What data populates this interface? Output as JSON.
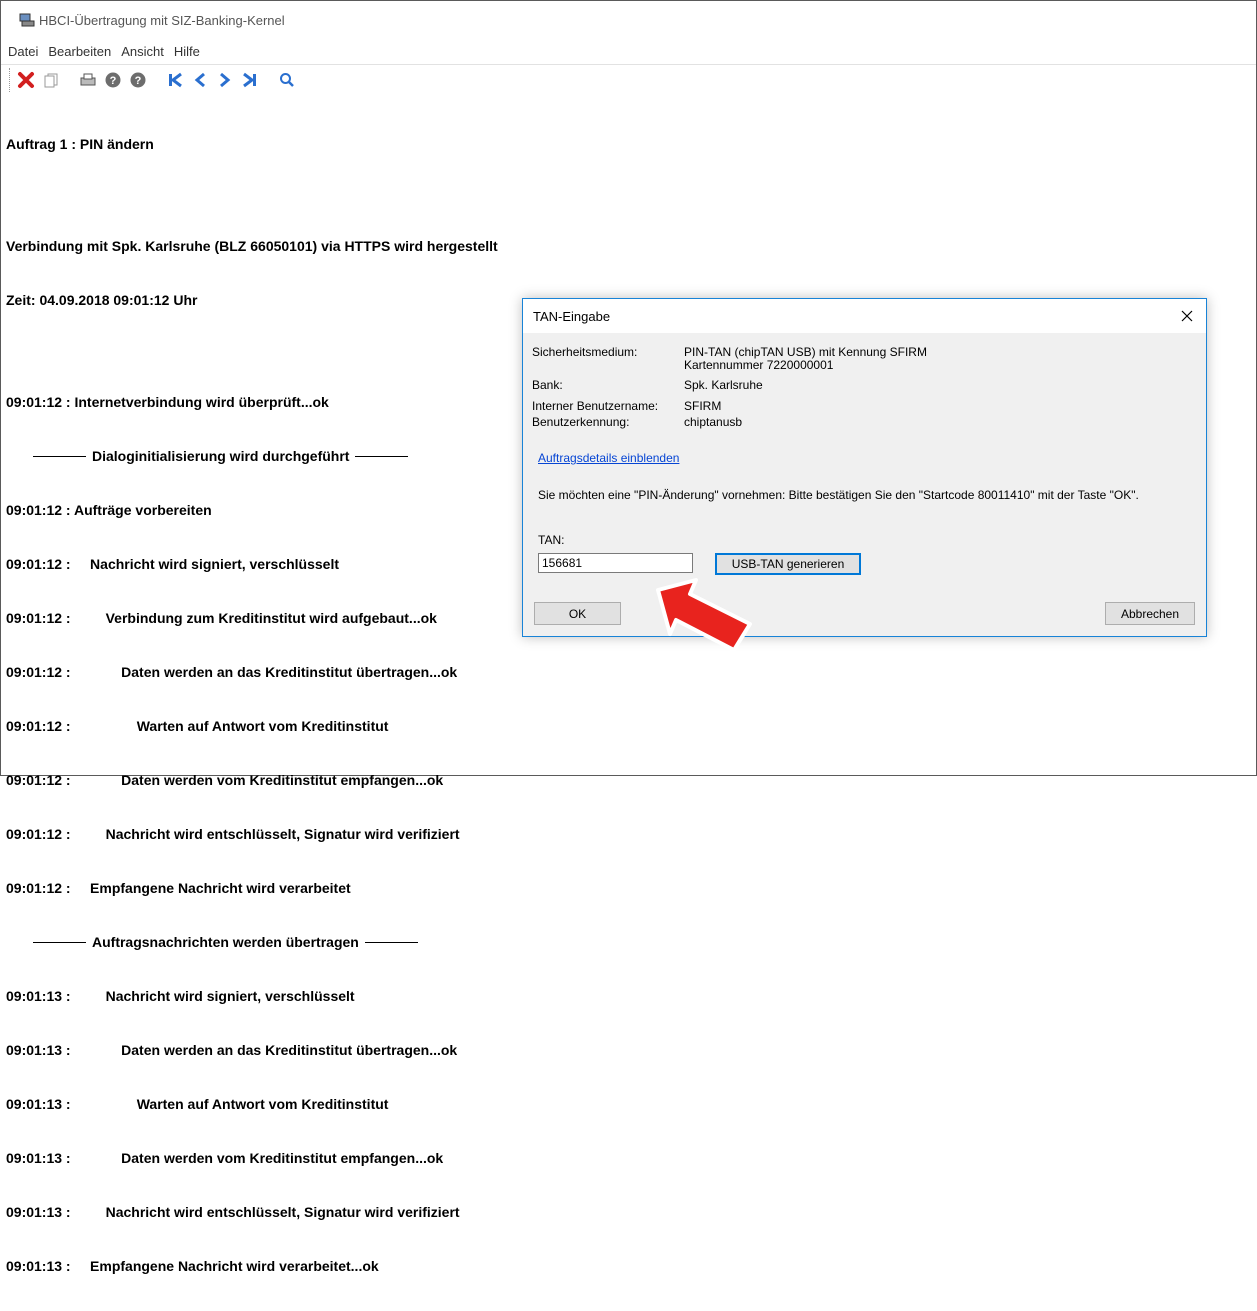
{
  "window": {
    "title": "HBCI-Übertragung mit SIZ-Banking-Kernel"
  },
  "menu": [
    "Datei",
    "Bearbeiten",
    "Ansicht",
    "Hilfe"
  ],
  "toolbar": {
    "icons": [
      "cancel-icon",
      "copy-icon",
      "print-icon",
      "help-icon",
      "info-icon",
      "first-icon",
      "prev-icon",
      "next-icon",
      "last-icon",
      "search-icon"
    ]
  },
  "log": {
    "lines": [
      "Auftrag 1 : PIN ändern",
      "",
      "Verbindung mit Spk. Karlsruhe (BLZ 66050101) via HTTPS wird hergestellt",
      "Zeit: 04.09.2018 09:01:12 Uhr",
      "",
      "09:01:12 : Internetverbindung wird überprüft...ok",
      "Dialoginitialisierung wird durchgeführt",
      "09:01:12 : Aufträge vorbereiten",
      "09:01:12 :     Nachricht wird signiert, verschlüsselt",
      "09:01:12 :         Verbindung zum Kreditinstitut wird aufgebaut...ok",
      "09:01:12 :             Daten werden an das Kreditinstitut übertragen...ok",
      "09:01:12 :                 Warten auf Antwort vom Kreditinstitut",
      "09:01:12 :             Daten werden vom Kreditinstitut empfangen...ok",
      "09:01:12 :         Nachricht wird entschlüsselt, Signatur wird verifiziert",
      "09:01:12 :     Empfangene Nachricht wird verarbeitet",
      "Auftragsnachrichten werden übertragen",
      "09:01:13 :         Nachricht wird signiert, verschlüsselt",
      "09:01:13 :             Daten werden an das Kreditinstitut übertragen...ok",
      "09:01:13 :                 Warten auf Antwort vom Kreditinstitut",
      "09:01:13 :             Daten werden vom Kreditinstitut empfangen...ok",
      "09:01:13 :         Nachricht wird entschlüsselt, Signatur wird verifiziert",
      "09:01:13 :     Empfangene Nachricht wird verarbeitet...ok"
    ]
  },
  "dialog": {
    "title": "TAN-Eingabe",
    "fields": [
      {
        "label": "Sicherheitsmedium:",
        "value": "PIN-TAN (chipTAN USB) mit Kennung SFIRM",
        "value2": "Kartennummer 7220000001"
      },
      {
        "label": "Bank:",
        "value": "Spk. Karlsruhe"
      },
      {
        "label": "Interner Benutzername:",
        "value": "SFIRM"
      },
      {
        "label": "Benutzerkennung:",
        "value": "chiptanusb"
      }
    ],
    "details_link": "Auftragsdetails einblenden",
    "message": "Sie möchten eine \"PIN-Änderung\" vornehmen: Bitte bestätigen Sie den \"Startcode 80011410\" mit der Taste \"OK\".",
    "tan_label": "TAN:",
    "tan_value": "156681",
    "generate_button": "USB-TAN generieren",
    "ok_button": "OK",
    "cancel_button": "Abbrechen"
  },
  "colors": {
    "arrow": "#e8231e",
    "link": "#0645d4",
    "dialog_border": "#1883d7",
    "toolbar_nav": "#2a6fcf"
  }
}
